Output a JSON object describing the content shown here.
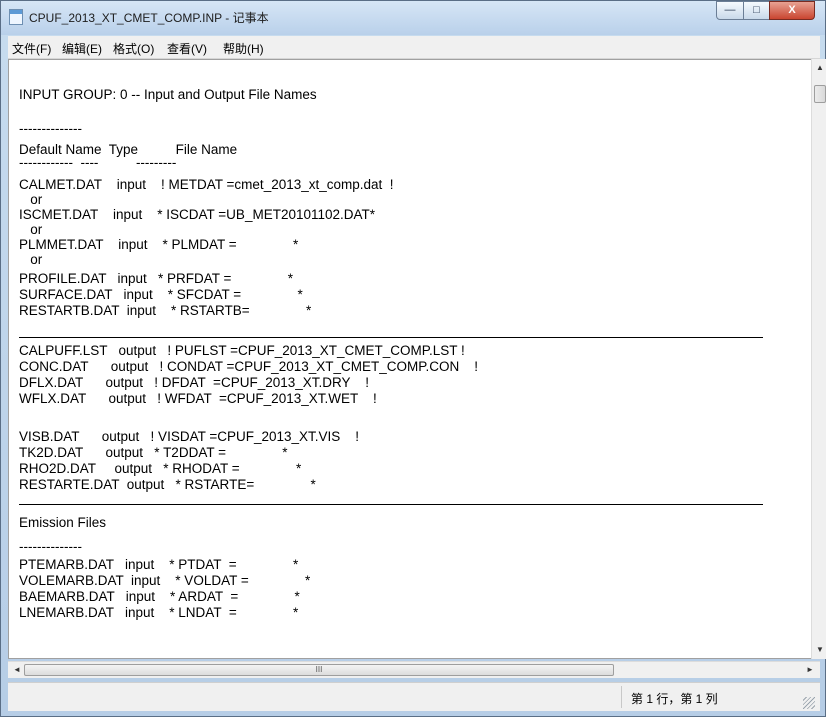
{
  "window": {
    "title": "CPUF_2013_XT_CMET_COMP.INP - 记事本",
    "controls": {
      "minimize": "—",
      "maximize": "□",
      "close": "X"
    }
  },
  "menu": {
    "items": [
      "文件(F)",
      "编辑(E)",
      "格式(O)",
      "查看(V)",
      "帮助(H)"
    ]
  },
  "document": {
    "lines": [
      "INPUT GROUP: 0 -- Input and Output File Names",
      "--------------",
      "Default Name  Type          File Name",
      "------------  ----          ---------",
      "CALMET.DAT    input    ! METDAT =cmet_2013_xt_comp.dat  !",
      "   or",
      "ISCMET.DAT    input    * ISCDAT =UB_MET20101102.DAT*",
      "   or",
      "PLMMET.DAT    input    * PLMDAT =               *",
      "   or",
      "PROFILE.DAT   input   * PRFDAT =               *",
      "SURFACE.DAT   input    * SFCDAT =               *",
      "RESTARTB.DAT  input    * RSTARTB=               *",
      "CALPUFF.LST   output   ! PUFLST =CPUF_2013_XT_CMET_COMP.LST !",
      "CONC.DAT      output   ! CONDAT =CPUF_2013_XT_CMET_COMP.CON    !",
      "DFLX.DAT      output   ! DFDAT  =CPUF_2013_XT.DRY    !",
      "WFLX.DAT      output   ! WFDAT  =CPUF_2013_XT.WET    !",
      "VISB.DAT      output   ! VISDAT =CPUF_2013_XT.VIS    !",
      "TK2D.DAT      output   * T2DDAT =               *",
      "RHO2D.DAT     output   * RHODAT =               *",
      "RESTARTE.DAT  output   * RSTARTE=               *",
      "Emission Files",
      "--------------",
      "PTEMARB.DAT   input    * PTDAT  =               *",
      "VOLEMARB.DAT  input    * VOLDAT =               *",
      "BAEMARB.DAT   input    * ARDAT  =               *",
      "LNEMARB.DAT   input    * LNDAT  =               *"
    ]
  },
  "scrollbar": {
    "thumb_grip": "III",
    "up": "▲",
    "down": "▼",
    "left": "◄",
    "right": "►"
  },
  "status": {
    "position": "第 1 行，第 1 列"
  }
}
